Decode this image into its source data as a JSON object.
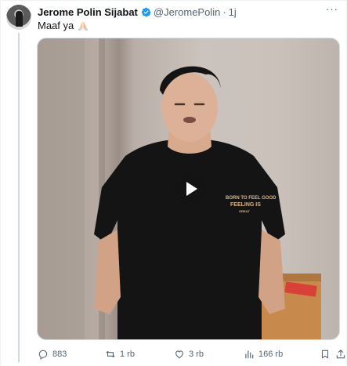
{
  "tweet": {
    "author_name": "Jerome Polin Sijabat",
    "handle": "@JeromePolin",
    "separator": "·",
    "time": "1j",
    "more_label": "···",
    "text": "Maaf ya",
    "emoji": "folded-hands-icon"
  },
  "media": {
    "shirt_text_top": "BORN TO FEEL GOOD",
    "shirt_text_main": "FEELING IS",
    "shirt_text_bottom": "GREAT"
  },
  "actions": {
    "replies": "883",
    "reposts": "1 rb",
    "likes": "3 rb",
    "views": "166 rb"
  },
  "colors": {
    "text": "#0f1419",
    "muted": "#536471",
    "verified": "#1d9bf0",
    "border": "#eff3f4"
  }
}
